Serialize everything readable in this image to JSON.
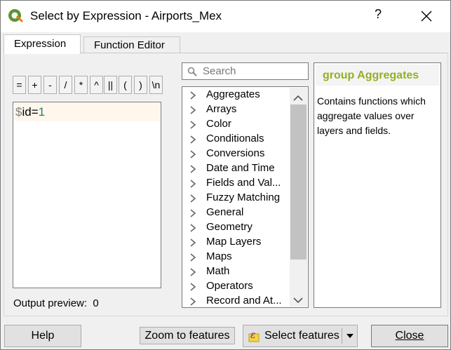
{
  "window": {
    "title": "Select by Expression - Airports_Mex",
    "help_glyph": "?",
    "app_icon": "qgis-logo-icon",
    "close_icon": "close-icon"
  },
  "tabs": [
    {
      "label": "Expression"
    },
    {
      "label": "Function Editor"
    }
  ],
  "operators": [
    "=",
    "+",
    "-",
    "/",
    "*",
    "^",
    "||",
    "(",
    ")",
    "\\n"
  ],
  "editor": {
    "var": "$",
    "field": "id",
    "op": "=",
    "value": "1"
  },
  "preview": {
    "label": "Output preview:",
    "value": "0"
  },
  "search": {
    "placeholder": "Search",
    "icon": "search-icon"
  },
  "functions": [
    "Aggregates",
    "Arrays",
    "Color",
    "Conditionals",
    "Conversions",
    "Date and Time",
    "Fields and Val...",
    "Fuzzy Matching",
    "General",
    "Geometry",
    "Map Layers",
    "Maps",
    "Math",
    "Operators",
    "Record and At..."
  ],
  "help_panel": {
    "title": "group Aggregates",
    "description": "Contains functions which aggregate values over layers and fields."
  },
  "buttons": {
    "help": "Help",
    "zoom": "Zoom to features",
    "select": "Select features",
    "close": "Close"
  },
  "colors": {
    "help_title": "#93b023",
    "editor_highlight": "#fff6ec",
    "number": "#1a8080"
  }
}
